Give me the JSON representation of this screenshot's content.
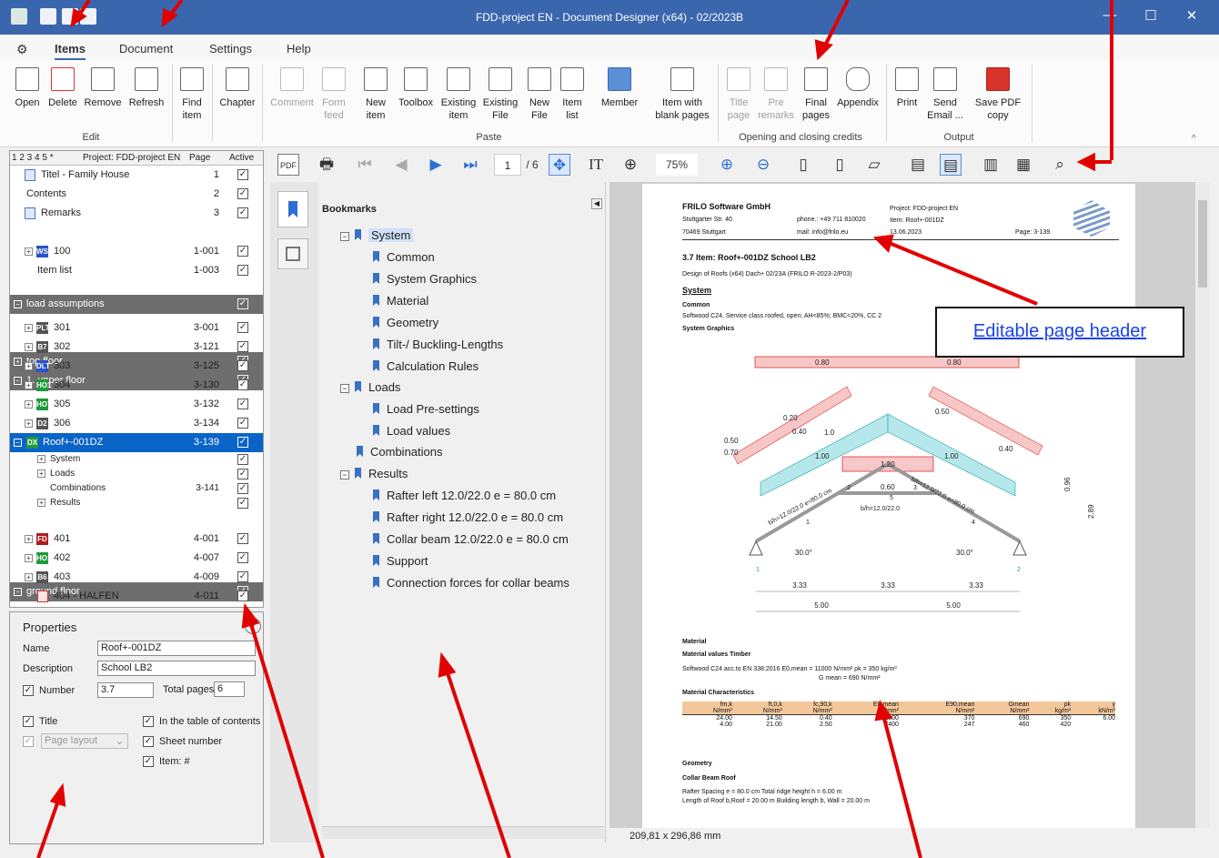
{
  "window": {
    "title": "FDD-project EN  - Document Designer (x64) - 02/2023B"
  },
  "menu": [
    "Items",
    "Document",
    "Settings",
    "Help"
  ],
  "ribbon": {
    "edit": {
      "group": "Edit",
      "open": "Open",
      "delete": "Delete",
      "remove": "Remove",
      "refresh": "Refresh",
      "find_item": "Find item"
    },
    "paste": {
      "group": "Paste",
      "chapter": "Chapter",
      "comment": "Comment",
      "form_feed": "Form feed",
      "new_item": "New item",
      "toolbox": "Toolbox",
      "existing_item": "Existing item",
      "existing_file": "Existing File",
      "new_file": "New File",
      "item_list": "Item list",
      "member": "Member",
      "blank_pages": "Item with blank pages"
    },
    "credits": {
      "group": "Opening  and closing credits",
      "title_page": "Title page",
      "pre_remarks": "Pre remarks",
      "final_pages": "Final pages",
      "appendix": "Appendix"
    },
    "output": {
      "group": "Output",
      "print": "Print",
      "send_email": "Send Email ...",
      "save_pdf": "Save PDF copy"
    }
  },
  "tree": {
    "header": {
      "levels": "1 2 3 4 5  *",
      "project": "Project: FDD-project EN",
      "page": "Page",
      "active": "Active"
    },
    "rows": [
      {
        "label": "Titel - Family House",
        "page": "1"
      },
      {
        "label": "Contents",
        "page": "2"
      },
      {
        "label": "Remarks",
        "page": "3"
      },
      {
        "label": "load assumptions",
        "page": ""
      },
      {
        "label": "100",
        "page": "1-001",
        "badge": "WS"
      },
      {
        "label": "Item list",
        "page": "1-003"
      },
      {
        "label": "top floor",
        "page": ""
      },
      {
        "label": "1. upper floor",
        "page": ""
      },
      {
        "label": "301",
        "page": "3-001",
        "badge": "PLT"
      },
      {
        "label": "302",
        "page": "3-121",
        "badge": "B7"
      },
      {
        "label": "303",
        "page": "3-125",
        "badge": "DLT"
      },
      {
        "label": "304",
        "page": "3-130",
        "badge": "HO1"
      },
      {
        "label": "305",
        "page": "3-132",
        "badge": "HO7"
      },
      {
        "label": "306",
        "page": "3-134",
        "badge": "D2"
      },
      {
        "label": "Roof+-001DZ",
        "page": "3-139",
        "badge": "DX"
      },
      {
        "label": "System",
        "page": ""
      },
      {
        "label": "Loads",
        "page": ""
      },
      {
        "label": "Combinations",
        "page": "3-141"
      },
      {
        "label": "Results",
        "page": ""
      },
      {
        "label": "ground floor",
        "page": ""
      },
      {
        "label": "401",
        "page": "4-001",
        "badge": "FD"
      },
      {
        "label": "402",
        "page": "4-007",
        "badge": "HO1"
      },
      {
        "label": "403",
        "page": "4-009",
        "badge": "B6"
      },
      {
        "label": "404 - HALFEN",
        "page": "4-011"
      }
    ]
  },
  "properties": {
    "title": "Properties",
    "name_label": "Name",
    "name_value": "Roof+-001DZ",
    "description_label": "Description",
    "description_value": "School LB2",
    "number_label": "Number",
    "number_value": "3.7",
    "total_pages_label": "Total pages",
    "total_pages_value": "6",
    "title_cb": "Title",
    "page_layout": "Page layout",
    "toc_cb": "In the table of contents",
    "sheet_cb": "Sheet number",
    "item_cb": "Item: #"
  },
  "viewer": {
    "page_current": "1",
    "page_total": "/ 6",
    "zoom": "75%",
    "page_size": "209,81 x 296,86 mm"
  },
  "bookmarks": {
    "title": "Bookmarks",
    "items": [
      "System",
      "Common",
      "System Graphics",
      "Material",
      "Geometry",
      "Tilt-/ Buckling-Lengths",
      "Calculation Rules",
      "Loads",
      "Load Pre-settings",
      "Load values",
      "Combinations",
      "Results",
      "Rafter left 12.0/22.0  e = 80.0 cm",
      "Rafter right 12.0/22.0  e = 80.0 cm",
      "Collar beam 12.0/22.0  e = 80.0 cm",
      "Support",
      "Connection forces for collar beams"
    ]
  },
  "doc": {
    "company": "FRILO Software GmbH",
    "street": "Stuttgarter Str. 40",
    "city": "70469    Stuttgart",
    "phone": "phone.: +49 711 810020",
    "mail": "mail: info@frilo.eu",
    "project": "Project: FDD-project EN",
    "item": "Item: Roof+-001DZ",
    "date": "13.06.2023",
    "pageno": "Page: 3-139",
    "heading": "3.7 Item: Roof+-001DZ  School LB2",
    "design": "Design of Roofs (x64) Dach+ 02/23A (FRILO R-2023-2/P03)",
    "system": "System",
    "common": "Common",
    "common_text": "Softwood C24, Service class roofed, open; AH<85%; BMC<20%, CC 2",
    "graphics": "System Graphics",
    "material": "Material",
    "mat_values": "Material values Timber",
    "mat_line": "Softwood C24 acc.to EN 338:2016     E0,mean  =  11000  N/mm²          ρk  =  350  kg/m³",
    "mat_line2": "G mean  =  690  N/mm²",
    "mat_char": "Material Characteristics",
    "table_head": [
      "fm,k",
      "ft,0,k",
      "fc,90,k",
      "E0,mean",
      "E90,mean",
      "Gmean",
      "ρk",
      "γ"
    ],
    "table_units": [
      "N/mm²",
      "N/mm²",
      "N/mm²",
      "N/mm²",
      "N/mm²",
      "N/mm²",
      "kg/m³",
      "kN/m³"
    ],
    "table_r1": [
      "24.00",
      "14.50",
      "0.40",
      "11000",
      "370",
      "690",
      "350",
      "6.00"
    ],
    "table_r2": [
      "4.00",
      "21.00",
      "2.50",
      "7400",
      "247",
      "460",
      "420",
      ""
    ],
    "geometry": "Geometry",
    "collar": "Collar Beam Roof",
    "geo1": "Rafter Spacing         e  =  80.0  cm     Total ridge height      h  =  6.00  m",
    "geo2": "Length of Roof   b,Roof  =  20.00  m     Building length       b, Wall  =  20.00  m",
    "dims": [
      "3.33",
      "3.33",
      "3.33",
      "5.00",
      "5.00"
    ],
    "loads": [
      "0.80",
      "0.80",
      "0.20",
      "0.40",
      "1.0",
      "0.50",
      "0.70",
      "1.00",
      "1.20",
      "0.60",
      "1.00",
      "0.50",
      "0.40",
      "0.96",
      "2.89"
    ],
    "angles": [
      "30.0°",
      "30.0°"
    ],
    "members": [
      "b/h=12.0/22.0 e=80.0 cm",
      "b/h=12.0/22.0",
      "b/h=12.0/22.0 e=80.0 cm"
    ],
    "nodes": [
      "1",
      "2",
      "3",
      "4",
      "5",
      "1",
      "2"
    ]
  },
  "callout": "Editable page header"
}
